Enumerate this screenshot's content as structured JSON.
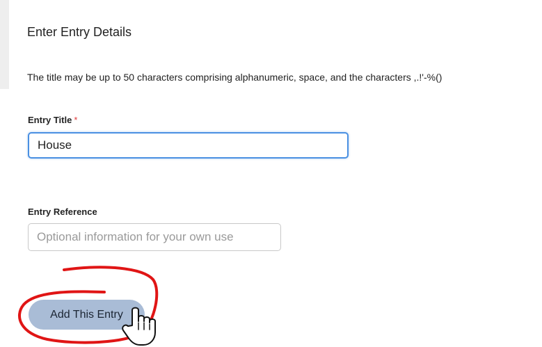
{
  "form": {
    "section_title": "Enter Entry Details",
    "help_text": "The title may be up to 50 characters comprising alphanumeric, space, and the characters ,.!'-%()",
    "title_field": {
      "label": "Entry Title",
      "required_marker": "*",
      "value": "House"
    },
    "reference_field": {
      "label": "Entry Reference",
      "value": "",
      "placeholder": "Optional information for your own use"
    },
    "submit_label": "Add This Entry"
  },
  "colors": {
    "focus_border": "#4a90e2",
    "button_background": "#a9bcd6",
    "required_marker": "#e03b3b",
    "annotation_stroke": "#e01515"
  },
  "overlay": {
    "annotation": "red-circle-around-button",
    "cursor": "hand-pointer-icon"
  }
}
